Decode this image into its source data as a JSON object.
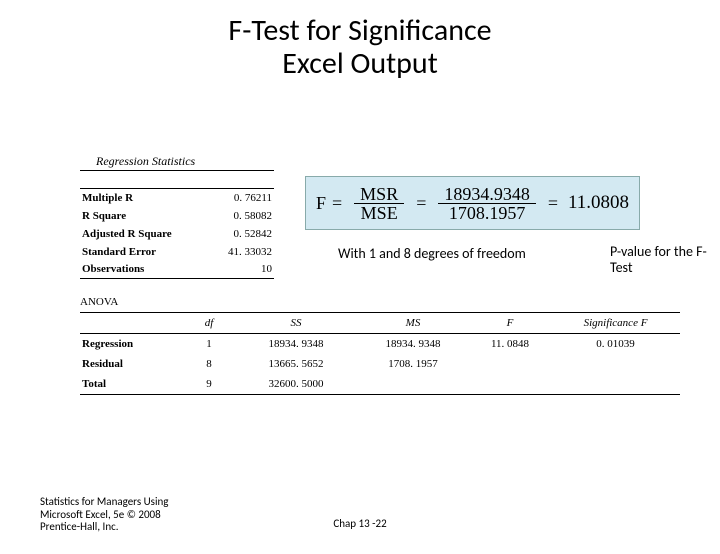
{
  "title_line1": "F-Test for Significance",
  "title_line2": "Excel Output",
  "regression_stats": {
    "header": "Regression Statistics",
    "rows": [
      {
        "label": "Multiple R",
        "value": "0. 76211"
      },
      {
        "label": "R Square",
        "value": "0. 58082"
      },
      {
        "label": "Adjusted R Square",
        "value": "0. 52842"
      },
      {
        "label": "Standard Error",
        "value": "41. 33032"
      },
      {
        "label": "Observations",
        "value": "10"
      }
    ]
  },
  "formula": {
    "lhs_num": "MSR",
    "lhs_den": "MSE",
    "mid_num": "18934.9348",
    "mid_den": "1708.1957",
    "result": "11.0808"
  },
  "note_df": "With 1 and 8 degrees of freedom",
  "note_pval": "P-value for the F-Test",
  "anova": {
    "label": "ANOVA",
    "headers": {
      "df": "df",
      "ss": "SS",
      "ms": "MS",
      "f": "F",
      "sigf": "Significance F"
    },
    "rows": [
      {
        "label": "Regression",
        "df": "1",
        "ss": "18934. 9348",
        "ms": "18934. 9348",
        "f": "11. 0848",
        "sigf": "0. 01039"
      },
      {
        "label": "Residual",
        "df": "8",
        "ss": "13665. 5652",
        "ms": "1708. 1957",
        "f": "",
        "sigf": ""
      },
      {
        "label": "Total",
        "df": "9",
        "ss": "32600. 5000",
        "ms": "",
        "f": "",
        "sigf": ""
      }
    ]
  },
  "footer_left": "Statistics for Managers Using Microsoft Excel, 5e © 2008 Prentice-Hall, Inc.",
  "footer_center": "Chap 13 -22",
  "chart_data": {
    "type": "table",
    "title": "F-Test for Significance — Excel Regression Output",
    "regression_statistics": {
      "Multiple R": 0.76211,
      "R Square": 0.58082,
      "Adjusted R Square": 0.52842,
      "Standard Error": 41.33032,
      "Observations": 10
    },
    "anova": {
      "columns": [
        "Source",
        "df",
        "SS",
        "MS",
        "F",
        "Significance F"
      ],
      "rows": [
        [
          "Regression",
          1,
          18934.9348,
          18934.9348,
          11.0848,
          0.01039
        ],
        [
          "Residual",
          8,
          13665.5652,
          1708.1957,
          null,
          null
        ],
        [
          "Total",
          9,
          32600.5,
          null,
          null,
          null
        ]
      ]
    },
    "annotations": [
      "F = MSR / MSE = 18934.9348 / 1708.1957 = 11.0808",
      "With 1 and 8 degrees of freedom",
      "P-value for the F-Test"
    ]
  }
}
